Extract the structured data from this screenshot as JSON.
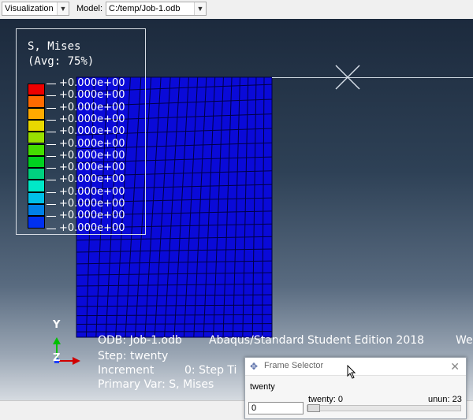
{
  "toolbar": {
    "module_value": "Visualization",
    "model_label": "Model:",
    "model_value": "C:/temp/Job-1.odb"
  },
  "legend": {
    "title_line1": "S, Mises",
    "title_line2": "(Avg: 75%)",
    "values": [
      "+0.000e+00",
      "+0.000e+00",
      "+0.000e+00",
      "+0.000e+00",
      "+0.000e+00",
      "+0.000e+00",
      "+0.000e+00",
      "+0.000e+00",
      "+0.000e+00",
      "+0.000e+00",
      "+0.000e+00",
      "+0.000e+00",
      "+0.000e+00"
    ],
    "colors": [
      "#ee0000",
      "#ff6a00",
      "#ffaa00",
      "#e8d800",
      "#99e000",
      "#44dd00",
      "#00d020",
      "#00d080",
      "#00e8c8",
      "#00c0e8",
      "#0080e8",
      "#0030f0"
    ]
  },
  "mesh": {
    "color": "#0a0ad8",
    "line_color": "#000044"
  },
  "triad": {
    "y_label": "Y",
    "z_label": "Z"
  },
  "info": {
    "odb": "ODB: Job-1.odb",
    "edition": "Abaqus/Standard Student Edition 2018",
    "extra": "We",
    "step": "Step: twenty",
    "increment": "Increment",
    "step_time": "0: Step Ti",
    "primary_var": "Primary Var: S, Mises"
  },
  "frame_selector": {
    "title": "Frame Selector",
    "step_name": "twenty",
    "frame_label": "twenty: 0",
    "max_label": "unun: 23",
    "input_value": "0"
  }
}
